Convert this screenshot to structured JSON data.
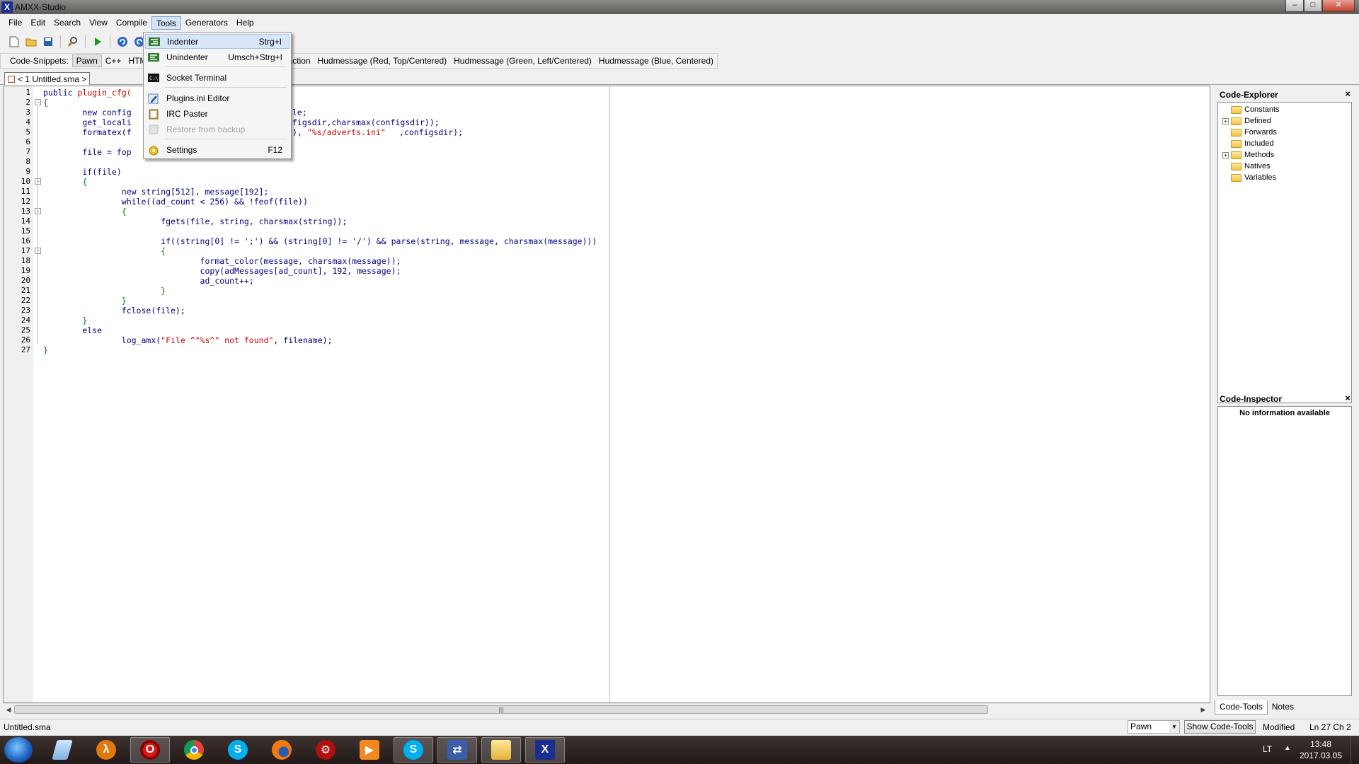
{
  "window": {
    "title": "AMXX-Studio",
    "minimize": "–",
    "maximize": "□",
    "close": "✕"
  },
  "menubar": [
    "File",
    "Edit",
    "Search",
    "View",
    "Compile",
    "Tools",
    "Generators",
    "Help"
  ],
  "snippets": {
    "label": "Code-Snippets:",
    "tabs": [
      "Pawn",
      "C++",
      "HTM"
    ],
    "items": [
      "...unction",
      "Hudmessage (Red, Top/Centered)",
      "Hudmessage (Green, Left/Centered)",
      "Hudmessage (Blue, Centered)"
    ]
  },
  "doc_tab": {
    "label": "< 1 Untitled.sma >"
  },
  "tools_menu": [
    {
      "label": "Indenter",
      "shortcut": "Strg+I",
      "icon": "indent-icon"
    },
    {
      "label": "Unindenter",
      "shortcut": "Umsch+Strg+I",
      "icon": "unindent-icon"
    },
    {
      "label": "Socket Terminal",
      "shortcut": "",
      "icon": "terminal-icon"
    },
    {
      "label": "Plugins.ini Editor",
      "shortcut": "",
      "icon": "edit-icon"
    },
    {
      "label": "IRC Paster",
      "shortcut": "",
      "icon": "clipboard-icon"
    },
    {
      "label": "Restore from backup",
      "shortcut": "",
      "icon": "restore-icon"
    },
    {
      "label": "Settings",
      "shortcut": "F12",
      "icon": "settings-icon"
    }
  ],
  "code_lines": [
    "public plugin_cfg(",
    "{",
    "        new config",
    "        get_locali",
    "        formatex(f",
    "",
    "        file = fop",
    "",
    "        if(file)",
    "        {",
    "                new string[512], message[192];",
    "                while((ad_count < 256) && !feof(file))",
    "                {",
    "                        fgets(file, string, charsmax(string));",
    "",
    "                        if((string[0] != ';') && (string[0] != '/') && parse(string, message, charsmax(message)))",
    "                        {",
    "                                format_color(message, charsmax(message));",
    "                                copy(adMessages[ad_count], 192, message);",
    "                                ad_count++;",
    "                        }",
    "                }",
    "                fclose(file);",
    "        }",
    "        else",
    "                log_amx(\"File ^\"%s^\" not found\", filename);",
    "}"
  ],
  "code_fragments": {
    "line3_rest": "le;",
    "line4_rest": "figsdir,charsmax(configsdir));",
    "line5_rest": "), ",
    "line5_string": "\"%s/adverts.ini\"",
    "line5_tail": ",configsdir);"
  },
  "code_explorer": {
    "title": "Code-Explorer",
    "items": [
      "Constants",
      "Defined",
      "Forwards",
      "Included",
      "Methods",
      "Natives",
      "Variables"
    ]
  },
  "code_inspector": {
    "title": "Code-Inspector",
    "message": "No information available"
  },
  "right_tabs": [
    "Code-Tools",
    "Notes"
  ],
  "statusbar": {
    "file": "Untitled.sma",
    "language": "Pawn",
    "show_tools": "Show Code-Tools",
    "modified": "Modified",
    "position": "Ln 27 Ch 2"
  },
  "taskbar": {
    "lang": "LT",
    "time": "13:48",
    "date": "2017.03.05"
  }
}
